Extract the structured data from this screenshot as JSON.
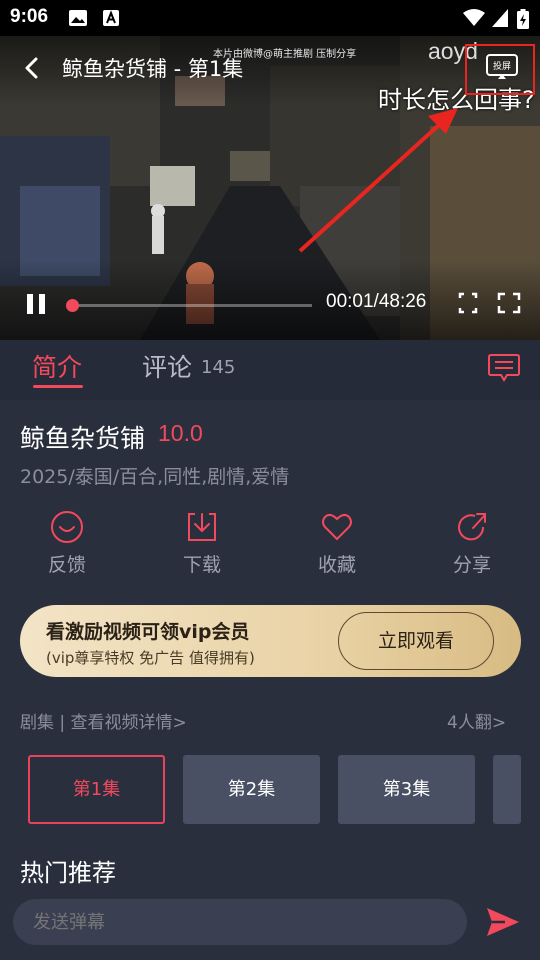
{
  "status_bar": {
    "time": "9:06"
  },
  "player": {
    "title": "鲸鱼杂货铺 - 第1集",
    "watermark": "本片由微博@萌主推剧 压制分享",
    "overlay_text": "aoyd",
    "annotation": "时长怎么回事?",
    "cast_label": "投屏",
    "time_display": "00:01/48:26",
    "progress_fraction": 0.0,
    "state": "playing"
  },
  "tabs": {
    "intro": "简介",
    "comments": "评论",
    "comments_count": "145"
  },
  "show": {
    "title": "鲸鱼杂货铺",
    "score": "10.0",
    "meta": "2025/泰国/百合,同性,剧情,爱情"
  },
  "actions": [
    {
      "label": "反馈",
      "icon": "feedback-icon"
    },
    {
      "label": "下载",
      "icon": "download-icon"
    },
    {
      "label": "收藏",
      "icon": "heart-icon"
    },
    {
      "label": "分享",
      "icon": "share-icon"
    }
  ],
  "vip": {
    "title": "看激励视频可领vip会员",
    "subtitle": "(vip尊享特权 免广告 值得拥有)",
    "button": "立即观看"
  },
  "episodes": {
    "label": "剧集 | 查看视频详情>",
    "translators": "4人翻>",
    "items": [
      "第1集",
      "第2集",
      "第3集"
    ]
  },
  "recommend": {
    "title": "热门推荐"
  },
  "danmaku": {
    "placeholder": "发送弹幕"
  },
  "colors": {
    "accent": "#f2495c",
    "background": "#2a2f3e",
    "vip_gold": "#e9d3a6"
  }
}
